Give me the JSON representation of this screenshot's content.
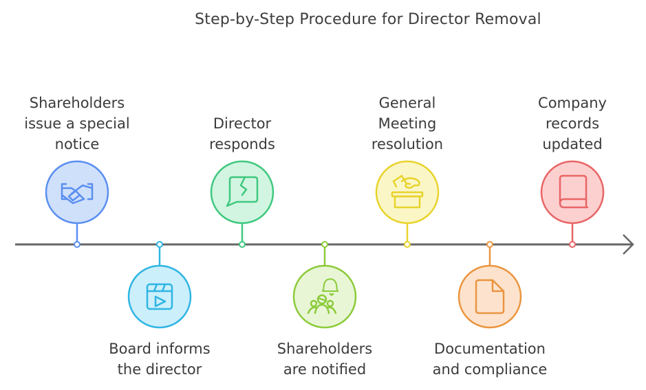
{
  "title": "Step-by-Step Procedure for Director Removal",
  "steps": [
    {
      "label": "Shareholders\nissue a special\nnotice",
      "icon": "handshake-icon",
      "position": "above",
      "stroke": "#5a8ef0",
      "fill": "#cfe0fb"
    },
    {
      "label": "Board informs\nthe director",
      "icon": "video-clapper-icon",
      "position": "below",
      "stroke": "#2fb5e3",
      "fill": "#cbeffb"
    },
    {
      "label": "Director\nresponds",
      "icon": "broken-message-icon",
      "position": "above",
      "stroke": "#3ec87e",
      "fill": "#d2f5e2"
    },
    {
      "label": "Shareholders\nare notified",
      "icon": "group-bell-icon",
      "position": "below",
      "stroke": "#8ccb3a",
      "fill": "#e8f6d6"
    },
    {
      "label": "General\nMeeting\nresolution",
      "icon": "ballot-box-icon",
      "position": "above",
      "stroke": "#e8d32c",
      "fill": "#fbf6c6"
    },
    {
      "label": "Documentation\nand compliance",
      "icon": "document-icon",
      "position": "below",
      "stroke": "#ea9540",
      "fill": "#fde3cd"
    },
    {
      "label": "Company\nrecords\nupdated",
      "icon": "book-icon",
      "position": "above",
      "stroke": "#e86565",
      "fill": "#fdd0d0"
    }
  ]
}
